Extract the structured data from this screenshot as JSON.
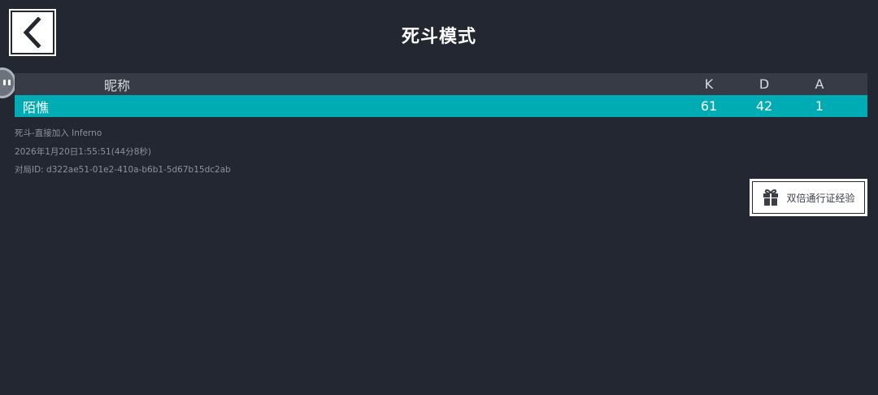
{
  "header": {
    "title": "死斗模式",
    "back_icon": "chevron-left-icon"
  },
  "table": {
    "columns": {
      "name": "昵称",
      "k": "K",
      "d": "D",
      "a": "A"
    },
    "rows": [
      {
        "name": "陌憔",
        "k": "61",
        "d": "42",
        "a": "1"
      }
    ],
    "highlight_color": "#00acb3"
  },
  "match_info": {
    "mode_map": "死斗-直接加入 Inferno",
    "datetime": "2026年1月20日1:55:51(44分8秒)",
    "match_id": "对局ID: d322ae51-01e2-410a-b6b1-5d67b15dc2ab"
  },
  "bonus_button": {
    "label": "双倍通行证经验",
    "icon": "gift-icon"
  },
  "colors": {
    "background": "#222731",
    "header_row": "#363b45"
  }
}
